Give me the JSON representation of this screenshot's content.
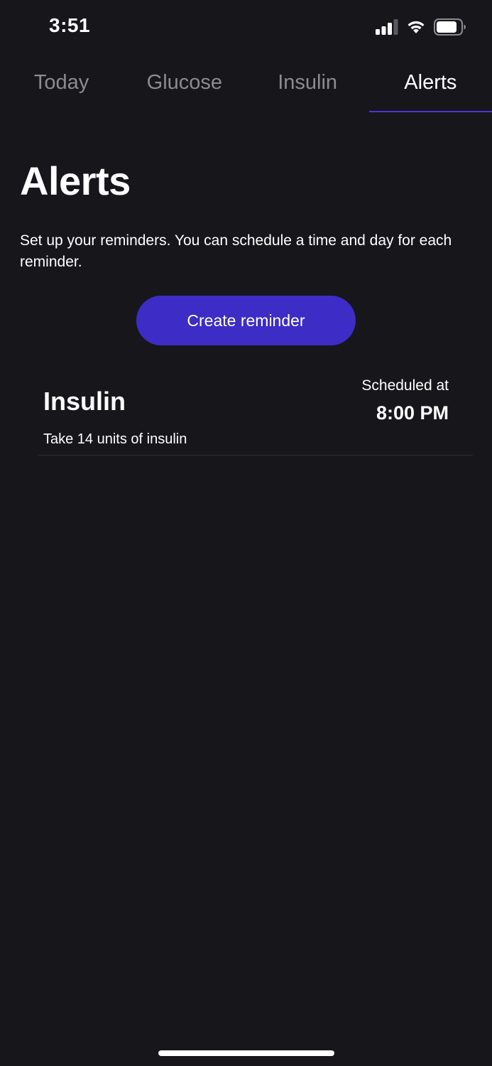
{
  "status_bar": {
    "time": "3:51",
    "icons": [
      "cellular-signal-icon",
      "wifi-icon",
      "battery-icon"
    ]
  },
  "tabs": [
    {
      "label": "Today",
      "active": false
    },
    {
      "label": "Glucose",
      "active": false
    },
    {
      "label": "Insulin",
      "active": false
    },
    {
      "label": "Alerts",
      "active": true
    }
  ],
  "main": {
    "title": "Alerts",
    "description": "Set up your reminders. You can schedule a time and day for each reminder.",
    "create_button_label": "Create reminder"
  },
  "reminders": [
    {
      "title": "Insulin",
      "description": "Take 14 units of insulin",
      "scheduled_label": "Scheduled at",
      "time": "8:00 PM"
    }
  ],
  "colors": {
    "background": "#17161b",
    "accent": "#3d2cc6",
    "tab_indicator": "#4a35d6",
    "inactive_tab_text": "#8c8b91"
  }
}
